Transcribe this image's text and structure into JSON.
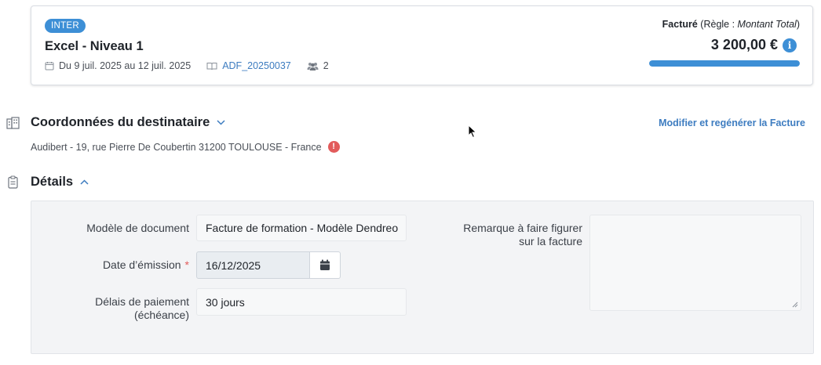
{
  "session": {
    "badge": "INTER",
    "title": "Excel - Niveau 1",
    "dates": "Du 9 juil. 2025 au 12 juil. 2025",
    "reference": "ADF_20250037",
    "participants": "2"
  },
  "invoice": {
    "status_label": "Facturé",
    "rule_prefix": " (Règle : ",
    "rule_value": "Montant Total",
    "rule_suffix": ")",
    "amount": "3 200,00 €",
    "info_glyph": "i",
    "progress_fraction": 1.0
  },
  "recipient": {
    "title": "Coordonnées du destinataire",
    "address": "Audibert - 19, rue Pierre De Coubertin 31200 TOULOUSE - France",
    "warning_glyph": "!",
    "regen_link": "Modifier et regénérer la Facture"
  },
  "details": {
    "title": "Détails",
    "doc_model_label": "Modèle de document",
    "doc_model_value": "Facture de formation - Modèle Dendreo",
    "issue_date_label": "Date d’émission",
    "required_mark": "*",
    "issue_date_value": "16/12/2025",
    "payment_label_1": "Délais de paiement",
    "payment_label_2": "(échéance)",
    "payment_value": "30 jours",
    "remark_label_1": "Remarque à faire figurer",
    "remark_label_2": "sur la facture",
    "remark_value": ""
  },
  "icons": {
    "calendar": "calendar-icon",
    "book": "book-icon",
    "users": "users-icon",
    "building": "building-icon",
    "clipboard": "clipboard-icon",
    "info": "info-icon",
    "warning": "warning-icon"
  },
  "colors": {
    "accent": "#3d8fd6",
    "link": "#3d7cc0",
    "warning": "#e25b5b",
    "panel_bg": "#f3f4f6"
  }
}
